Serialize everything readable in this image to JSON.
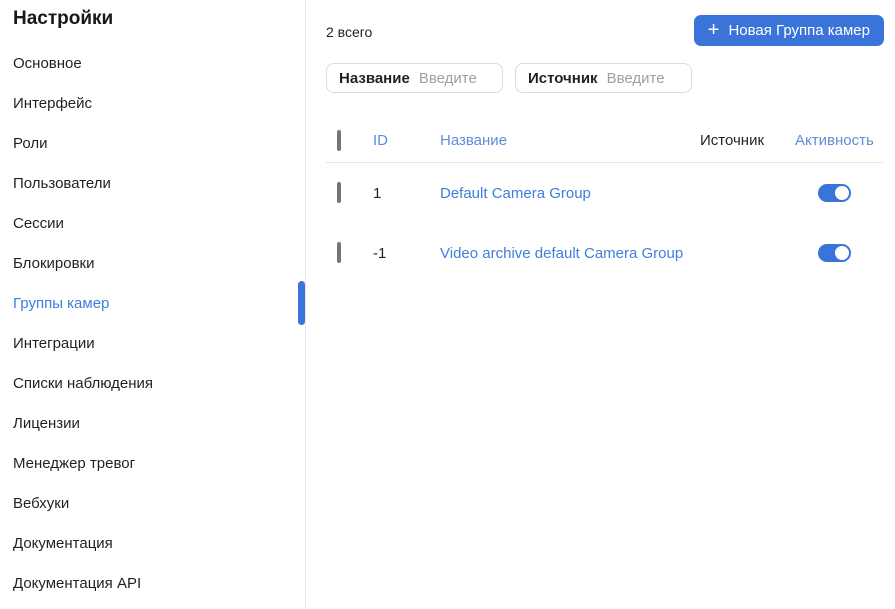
{
  "sidebar": {
    "title": "Настройки",
    "items": [
      {
        "label": "Основное"
      },
      {
        "label": "Интерфейс"
      },
      {
        "label": "Роли"
      },
      {
        "label": "Пользователи"
      },
      {
        "label": "Сессии"
      },
      {
        "label": "Блокировки"
      },
      {
        "label": "Группы камер",
        "active": true
      },
      {
        "label": "Интеграции"
      },
      {
        "label": "Списки наблюдения"
      },
      {
        "label": "Лицензии"
      },
      {
        "label": "Менеджер тревог"
      },
      {
        "label": "Вебхуки"
      },
      {
        "label": "Документация"
      },
      {
        "label": "Документация API"
      }
    ]
  },
  "toolbar": {
    "total_label": "2 всего",
    "new_group_button": "Новая Группа камер",
    "plus_icon": "+"
  },
  "filters": [
    {
      "label": "Название",
      "placeholder": "Введите"
    },
    {
      "label": "Источник",
      "placeholder": "Введите"
    }
  ],
  "table": {
    "columns": {
      "id": "ID",
      "name": "Название",
      "source": "Источник",
      "activity": "Активность"
    },
    "rows": [
      {
        "id": "1",
        "name": "Default Camera Group",
        "source": "",
        "active": true
      },
      {
        "id": "-1",
        "name": "Video archive default Camera Group",
        "source": "",
        "active": true
      }
    ]
  },
  "colors": {
    "primary_blue": "#3b74d9",
    "link_blue": "#3f7edb",
    "header_link_blue": "#5e8dda",
    "text_dark": "#1e2126",
    "placeholder_grey": "#9aa1ab",
    "border_grey": "#d9dde3",
    "divider_grey": "#e8eaee"
  }
}
